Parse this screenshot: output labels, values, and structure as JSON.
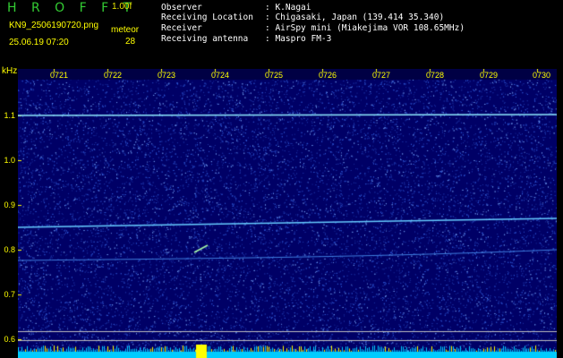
{
  "header": {
    "app_title": "H R O F F T",
    "version": "1.00f",
    "filename": "KN9_2506190720.png",
    "datetime": "25.06.19 07:20",
    "meteor_label": "meteor",
    "meteor_count": "28"
  },
  "info": [
    {
      "key": "Observer",
      "value": ": K.Nagai"
    },
    {
      "key": "Receiving Location",
      "value": ": Chigasaki, Japan (139.414 35.340)"
    },
    {
      "key": "Receiver",
      "value": ": AirSpy mini (Miakejima VOR 108.65MHz)"
    },
    {
      "key": "Receiving antenna",
      "value": ": Maspro FM-3"
    }
  ],
  "spectrogram": {
    "yaxis_unit": "kHz",
    "y_ticks": [
      "1.1",
      "1.0",
      "0.9",
      "0.8",
      "0.7",
      "0.6"
    ],
    "time_ticks": [
      "0721",
      "0722",
      "0723",
      "0724",
      "0725",
      "0726",
      "0727",
      "0728",
      "0729",
      "0730"
    ],
    "colors": {
      "background": "#000066",
      "trace": "#66ddff",
      "labels": "#ffff00"
    }
  }
}
